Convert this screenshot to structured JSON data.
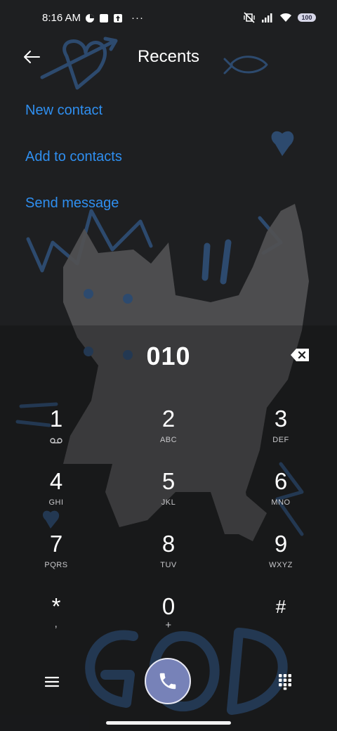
{
  "status_bar": {
    "time": "8:16 AM",
    "more_indicator": "···",
    "battery_level": "100",
    "icons": [
      "data-saver-icon",
      "notification-square-icon",
      "upload-icon",
      "muted-vibrate-icon",
      "signal-icon",
      "wifi-icon",
      "battery-icon"
    ]
  },
  "header": {
    "title": "Recents",
    "back_icon": "arrow-left-icon"
  },
  "actions": {
    "new_contact": "New contact",
    "add_to_contacts": "Add to contacts",
    "send_message": "Send message"
  },
  "dialed_number": "010",
  "keypad": {
    "keys": [
      {
        "digit": "1",
        "letters": "",
        "sub_icon": "voicemail-icon"
      },
      {
        "digit": "2",
        "letters": "ABC"
      },
      {
        "digit": "3",
        "letters": "DEF"
      },
      {
        "digit": "4",
        "letters": "GHI"
      },
      {
        "digit": "5",
        "letters": "JKL"
      },
      {
        "digit": "6",
        "letters": "MNO"
      },
      {
        "digit": "7",
        "letters": "PQRS"
      },
      {
        "digit": "8",
        "letters": "TUV"
      },
      {
        "digit": "9",
        "letters": "WXYZ"
      },
      {
        "digit": "*",
        "letters": ","
      },
      {
        "digit": "0",
        "letters": "+"
      },
      {
        "digit": "#",
        "letters": ""
      }
    ]
  },
  "bottom_bar": {
    "menu_icon": "hamburger-menu-icon",
    "call_icon": "phone-icon",
    "keypad_icon": "dialpad-icon"
  },
  "colors": {
    "background": "#1e1f21",
    "link_blue": "#2f8ff0",
    "call_button": "#7782b8",
    "wallpaper_doodle_blue": "#2d4a6e",
    "wallpaper_cat_gray": "#505052"
  }
}
